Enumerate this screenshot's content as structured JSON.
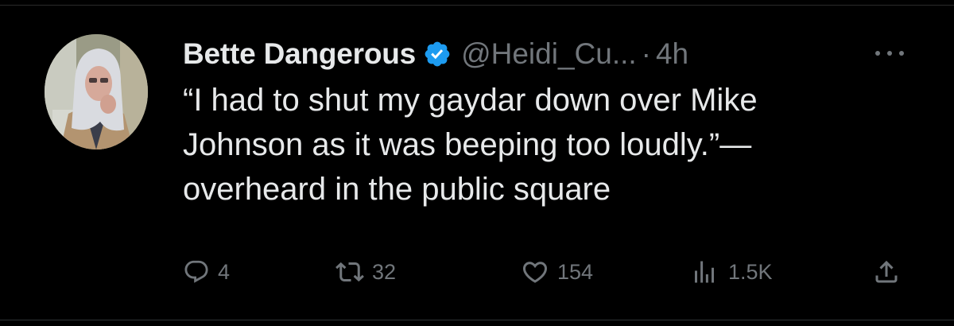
{
  "tweet": {
    "display_name": "Bette Dangerous",
    "verified": true,
    "handle": "@Heidi_Cu...",
    "separator": "·",
    "time": "4h",
    "text_lines": [
      "“I had to shut my gaydar down over Mike",
      "Johnson as it was beeping too loudly.”—",
      "overheard in the public square"
    ]
  },
  "actions": {
    "reply": {
      "icon": "reply-icon",
      "count": "4"
    },
    "retweet": {
      "icon": "retweet-icon",
      "count": "32"
    },
    "like": {
      "icon": "heart-icon",
      "count": "154"
    },
    "views": {
      "icon": "views-icon",
      "count": "1.5K"
    },
    "share": {
      "icon": "share-icon"
    }
  },
  "colors": {
    "background": "#000000",
    "primary_text": "#e7e9ea",
    "secondary_text": "#71767b",
    "verified_blue": "#1d9bf0"
  }
}
